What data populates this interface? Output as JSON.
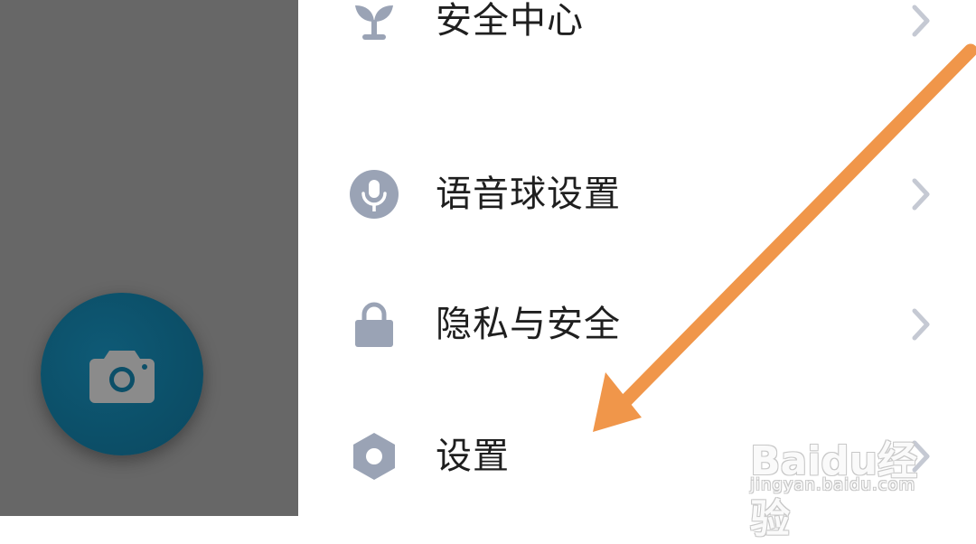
{
  "drawer": {
    "camera_icon": "camera-icon",
    "overlay_color": "#676767",
    "fab_color": "#0c4f68"
  },
  "menu": {
    "items": [
      {
        "label": "安全中心",
        "icon": "sprout-icon"
      },
      {
        "label": "语音球设置",
        "icon": "microphone-icon"
      },
      {
        "label": "隐私与安全",
        "icon": "lock-icon"
      },
      {
        "label": "设置",
        "icon": "hexagon-settings-icon"
      }
    ],
    "icon_color": "#9aa3b5",
    "chevron_color": "#c5c9d3"
  },
  "annotation": {
    "arrow_color": "#f0964a"
  },
  "watermark": {
    "brand": "Baidu经验",
    "url": "jingyan.baidu.com"
  }
}
